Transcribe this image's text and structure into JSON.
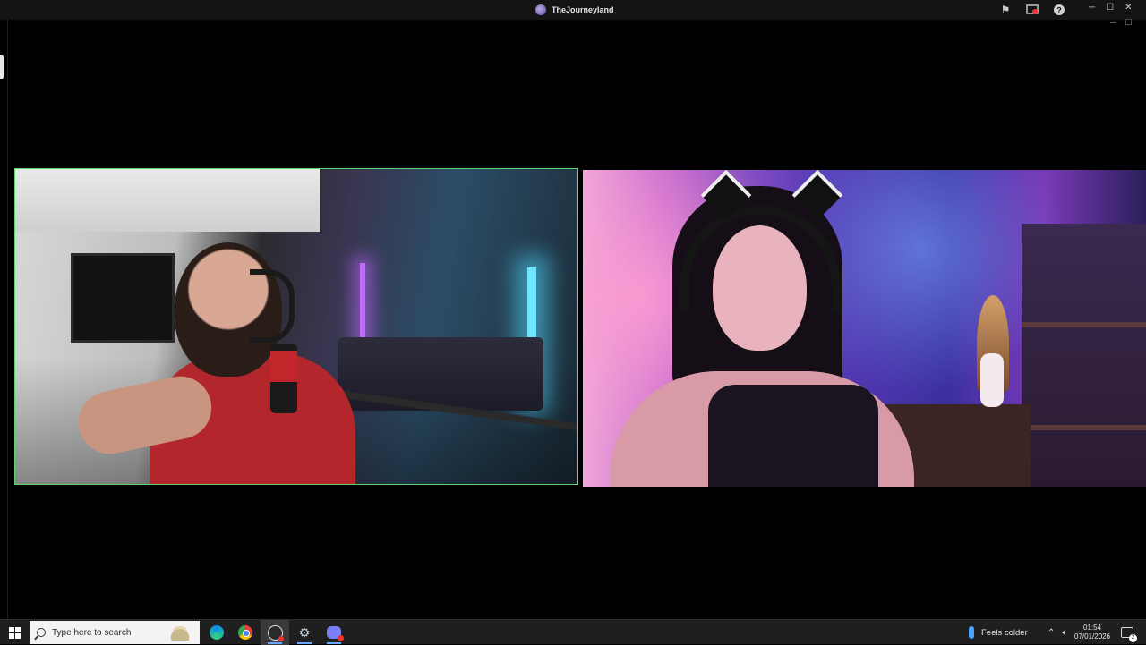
{
  "window": {
    "title": "TheJourneyland",
    "icons": [
      "flag-icon",
      "screen-record-icon",
      "help-icon"
    ],
    "controls": [
      "minimize",
      "maximize",
      "close"
    ]
  },
  "video": {
    "left": {
      "border_color": "#5fd36b",
      "speaking": true
    },
    "right": {
      "border_color": "",
      "speaking": false
    }
  },
  "taskbar": {
    "search_placeholder": "Type here to search",
    "apps": [
      "edge-icon",
      "chrome-icon",
      "obs-icon",
      "steam-icon",
      "discord-icon"
    ],
    "weather": "Feels colder",
    "time": "01:54",
    "date": "07/01/2026",
    "notification_count": "2",
    "accent": "#6aa6ff"
  }
}
